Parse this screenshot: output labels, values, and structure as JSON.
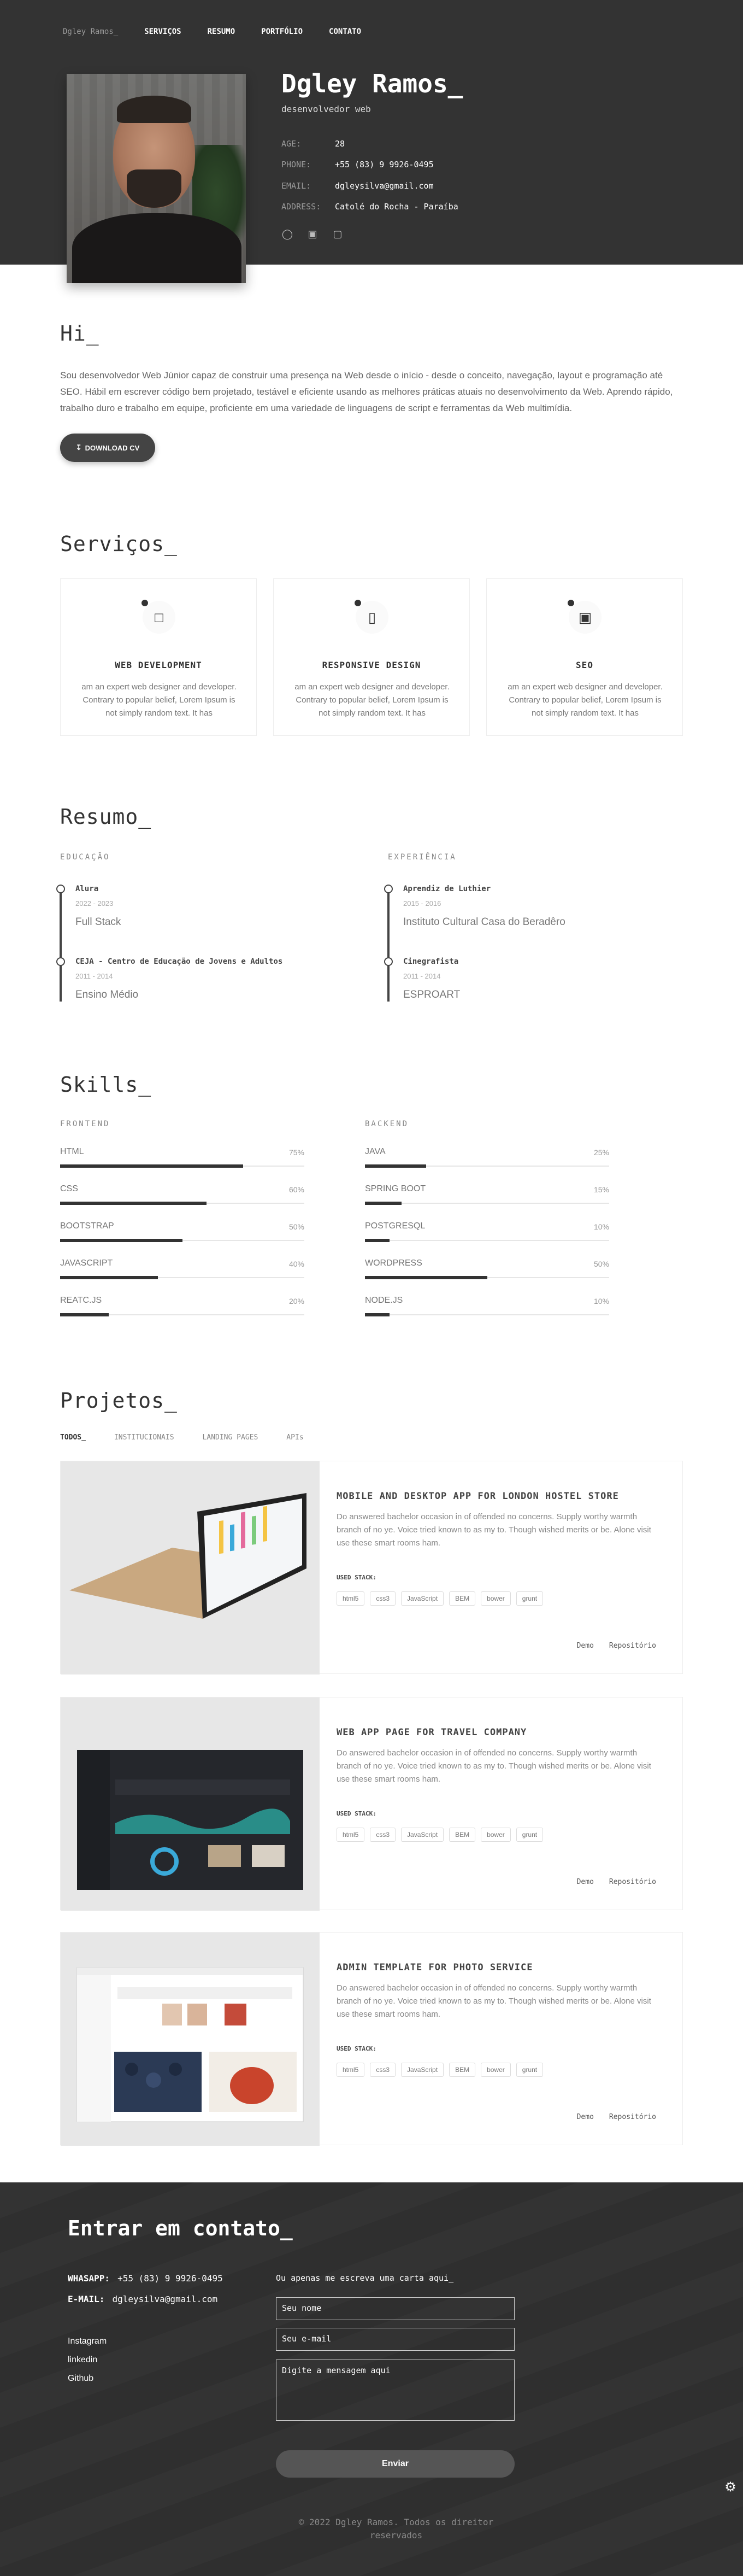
{
  "nav": {
    "brand": "Dgley Ramos_",
    "links": [
      "SERVIÇOS",
      "RESUMO",
      "PORTFÓLIO",
      "CONTATO"
    ]
  },
  "profile": {
    "name": "Dgley Ramos_",
    "role": "desenvolvedor web",
    "info": [
      {
        "k": "AGE:",
        "v": "28"
      },
      {
        "k": "PHONE:",
        "v": "+55 (83) 9 9926-0495"
      },
      {
        "k": "EMAIL:",
        "v": "dgleysilva@gmail.com"
      },
      {
        "k": "ADDRESS:",
        "v": "Catolé do Rocha - Paraíba"
      }
    ],
    "socials": [
      "github-icon",
      "linkedin-icon",
      "instagram-icon"
    ]
  },
  "about": {
    "title": "Hi_",
    "text": "Sou desenvolvedor Web Júnior capaz de construir uma presença na Web desde o início - desde o conceito, navegação, layout e programação até SEO. Hábil em escrever código bem projetado, testável e eficiente usando as melhores práticas atuais no desenvolvimento da Web. Aprendo rápido, trabalho duro e trabalho em equipe, proficiente em uma variedade de linguagens de script e ferramentas da Web multimídia.",
    "download": "DOWNLOAD CV"
  },
  "services": {
    "title": "Serviços_",
    "items": [
      {
        "icon": "laptop-icon",
        "title": "WEB DEVELOPMENT",
        "desc": "am an expert web designer and developer. Contrary to popular belief, Lorem Ipsum is not simply random text. It has"
      },
      {
        "icon": "mobile-icon",
        "title": "RESPONSIVE DESIGN",
        "desc": "am an expert web designer and developer. Contrary to popular belief, Lorem Ipsum is not simply random text. It has"
      },
      {
        "icon": "seo-icon",
        "title": "SEO",
        "desc": "am an expert web designer and developer. Contrary to popular belief, Lorem Ipsum is not simply random text. It has"
      }
    ]
  },
  "resume": {
    "title": "Resumo_",
    "education_label": "EDUCAÇÃO",
    "experience_label": "EXPERIÊNCIA",
    "education": [
      {
        "title": "Alura",
        "years": "2022 - 2023",
        "sub": "Full Stack"
      },
      {
        "title": "CEJA - Centro de Educação de Jovens e Adultos",
        "years": "2011 - 2014",
        "sub": "Ensino Médio"
      }
    ],
    "experience": [
      {
        "title": "Aprendiz de Luthier",
        "years": "2015 - 2016",
        "sub": "Instituto Cultural Casa do Beradêro"
      },
      {
        "title": "Cinegrafista",
        "years": "2011 - 2014",
        "sub": "ESPROART"
      }
    ]
  },
  "skills": {
    "title": "Skills_",
    "frontend_label": "FRONTEND",
    "backend_label": "BACKEND",
    "frontend": [
      {
        "name": "HTML",
        "pct": "75%",
        "value": 75
      },
      {
        "name": "CSS",
        "pct": "60%",
        "value": 60
      },
      {
        "name": "BOOTSTRAP",
        "pct": "50%",
        "value": 50
      },
      {
        "name": "JAVASCRIPT",
        "pct": "40%",
        "value": 40
      },
      {
        "name": "REATC.JS",
        "pct": "20%",
        "value": 20
      }
    ],
    "backend": [
      {
        "name": "JAVA",
        "pct": "25%",
        "value": 25
      },
      {
        "name": "SPRING BOOT",
        "pct": "15%",
        "value": 15
      },
      {
        "name": "POSTGRESQL",
        "pct": "10%",
        "value": 10
      },
      {
        "name": "WORDPRESS",
        "pct": "50%",
        "value": 50
      },
      {
        "name": "NODE.JS",
        "pct": "10%",
        "value": 10
      }
    ]
  },
  "projects": {
    "title": "Projetos_",
    "filters": [
      "TODOS_",
      "INSTITUCIONAIS",
      "LANDING PAGES",
      "APIs"
    ],
    "used_label": "USED STACK:",
    "tags": [
      "html5",
      "css3",
      "JavaScript",
      "BEM",
      "bower",
      "grunt"
    ],
    "demo": "Demo",
    "repo": "Repositório",
    "items": [
      {
        "title": "MOBILE AND DESKTOP APP FOR LONDON HOSTEL STORE",
        "desc": "Do answered bachelor occasion in of offended no concerns. Supply worthy warmth branch of no ye. Voice tried known to as my to. Though wished merits or be. Alone visit use these smart rooms ham."
      },
      {
        "title": "WEB APP PAGE FOR TRAVEL COMPANY",
        "desc": "Do answered bachelor occasion in of offended no concerns. Supply worthy warmth branch of no ye. Voice tried known to as my to. Though wished merits or be. Alone visit use these smart rooms ham."
      },
      {
        "title": "ADMIN TEMPLATE FOR PHOTO SERVICE",
        "desc": "Do answered bachelor occasion in of offended no concerns. Supply worthy warmth branch of no ye. Voice tried known to as my to. Though wished merits or be. Alone visit use these smart rooms ham."
      }
    ]
  },
  "contact": {
    "title": "Entrar em contato_",
    "whatsapp_label": "WHASAPP:",
    "whatsapp": "+55 (83) 9 9926-0495",
    "email_label": "E-MAIL:",
    "email": "dgleysilva@gmail.com",
    "socials": [
      "Instagram",
      "linkedin",
      "Github"
    ],
    "form_label": "Ou apenas me escreva uma carta aqui_",
    "name_ph": "Seu nome",
    "email_ph": "Seu e-mail",
    "msg_ph": "Digite a mensagem aqui",
    "send": "Enviar",
    "copyright": "© 2022 Dgley Ramos. Todos os direitor reservados"
  }
}
